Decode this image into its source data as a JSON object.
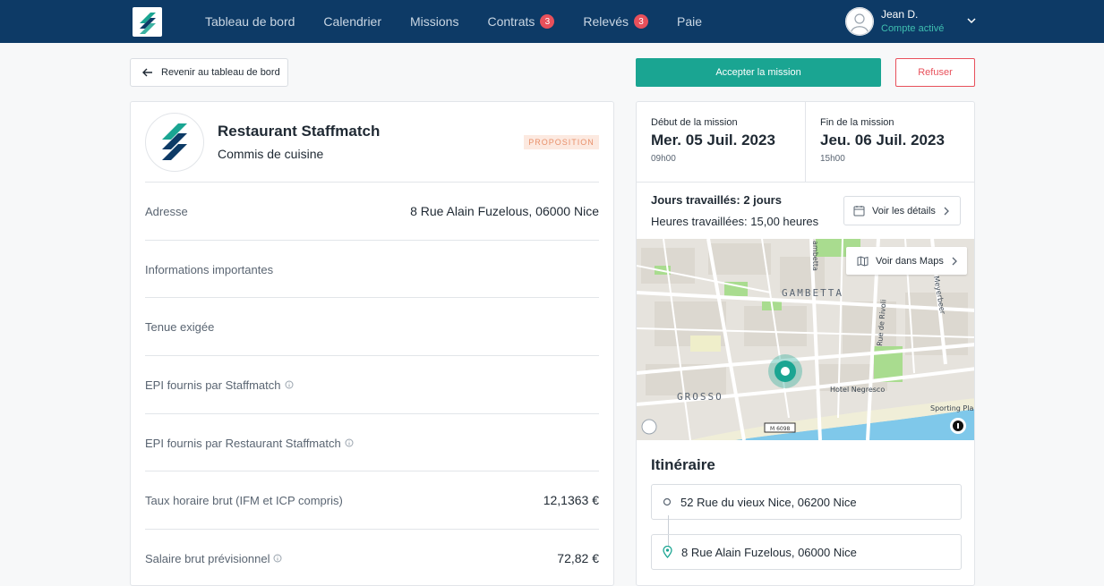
{
  "header": {
    "nav": [
      {
        "label": "Tableau de bord",
        "badge": null
      },
      {
        "label": "Calendrier",
        "badge": null
      },
      {
        "label": "Missions",
        "badge": null
      },
      {
        "label": "Contrats",
        "badge": "3"
      },
      {
        "label": "Relevés",
        "badge": "3"
      },
      {
        "label": "Paie",
        "badge": null
      }
    ],
    "user": {
      "name": "Jean D.",
      "status": "Compte activé"
    }
  },
  "actions": {
    "back_label": "Revenir au tableau de bord",
    "accept_label": "Accepter la mission",
    "refuse_label": "Refuser"
  },
  "mission": {
    "company": "Restaurant Staffmatch",
    "job": "Commis de cuisine",
    "status": "PROPOSITION",
    "rows": [
      {
        "label": "Adresse",
        "value": "8 Rue Alain Fuzelous, 06000 Nice",
        "info": false
      },
      {
        "label": "Informations importantes",
        "value": "",
        "info": false
      },
      {
        "label": "Tenue exigée",
        "value": "",
        "info": false
      },
      {
        "label": "EPI fournis par Staffmatch",
        "value": "",
        "info": true
      },
      {
        "label": "EPI fournis par Restaurant Staffmatch",
        "value": "",
        "info": true
      },
      {
        "label": "Taux horaire brut (IFM et ICP compris)",
        "value": "12,1363 €",
        "info": false
      },
      {
        "label": "Salaire brut prévisionnel",
        "value": "72,82 €",
        "info": true
      }
    ]
  },
  "schedule": {
    "start": {
      "label": "Début de la mission",
      "date": "Mer. 05 Juil. 2023",
      "time": "09h00"
    },
    "end": {
      "label": "Fin de la mission",
      "date": "Jeu. 06 Juil. 2023",
      "time": "15h00"
    },
    "days": "Jours travaillés: 2 jours",
    "hours": "Heures travaillées: 15,00 heures",
    "details_label": "Voir les détails"
  },
  "map": {
    "maps_label": "Voir dans Maps",
    "labels": [
      "GAMBETTA",
      "GROSSO",
      "Hotel Negresco",
      "Sporting Pla",
      "Rue de Rivoli",
      "Meyerbeer",
      "ambetta",
      "M 6098"
    ]
  },
  "itinerary": {
    "title": "Itinéraire",
    "from": "52 Rue du vieux Nice, 06200 Nice",
    "to": "8 Rue Alain Fuzelous, 06000 Nice"
  },
  "colors": {
    "navy": "#0d3a66",
    "teal": "#1aa592",
    "red": "#e8505b"
  }
}
